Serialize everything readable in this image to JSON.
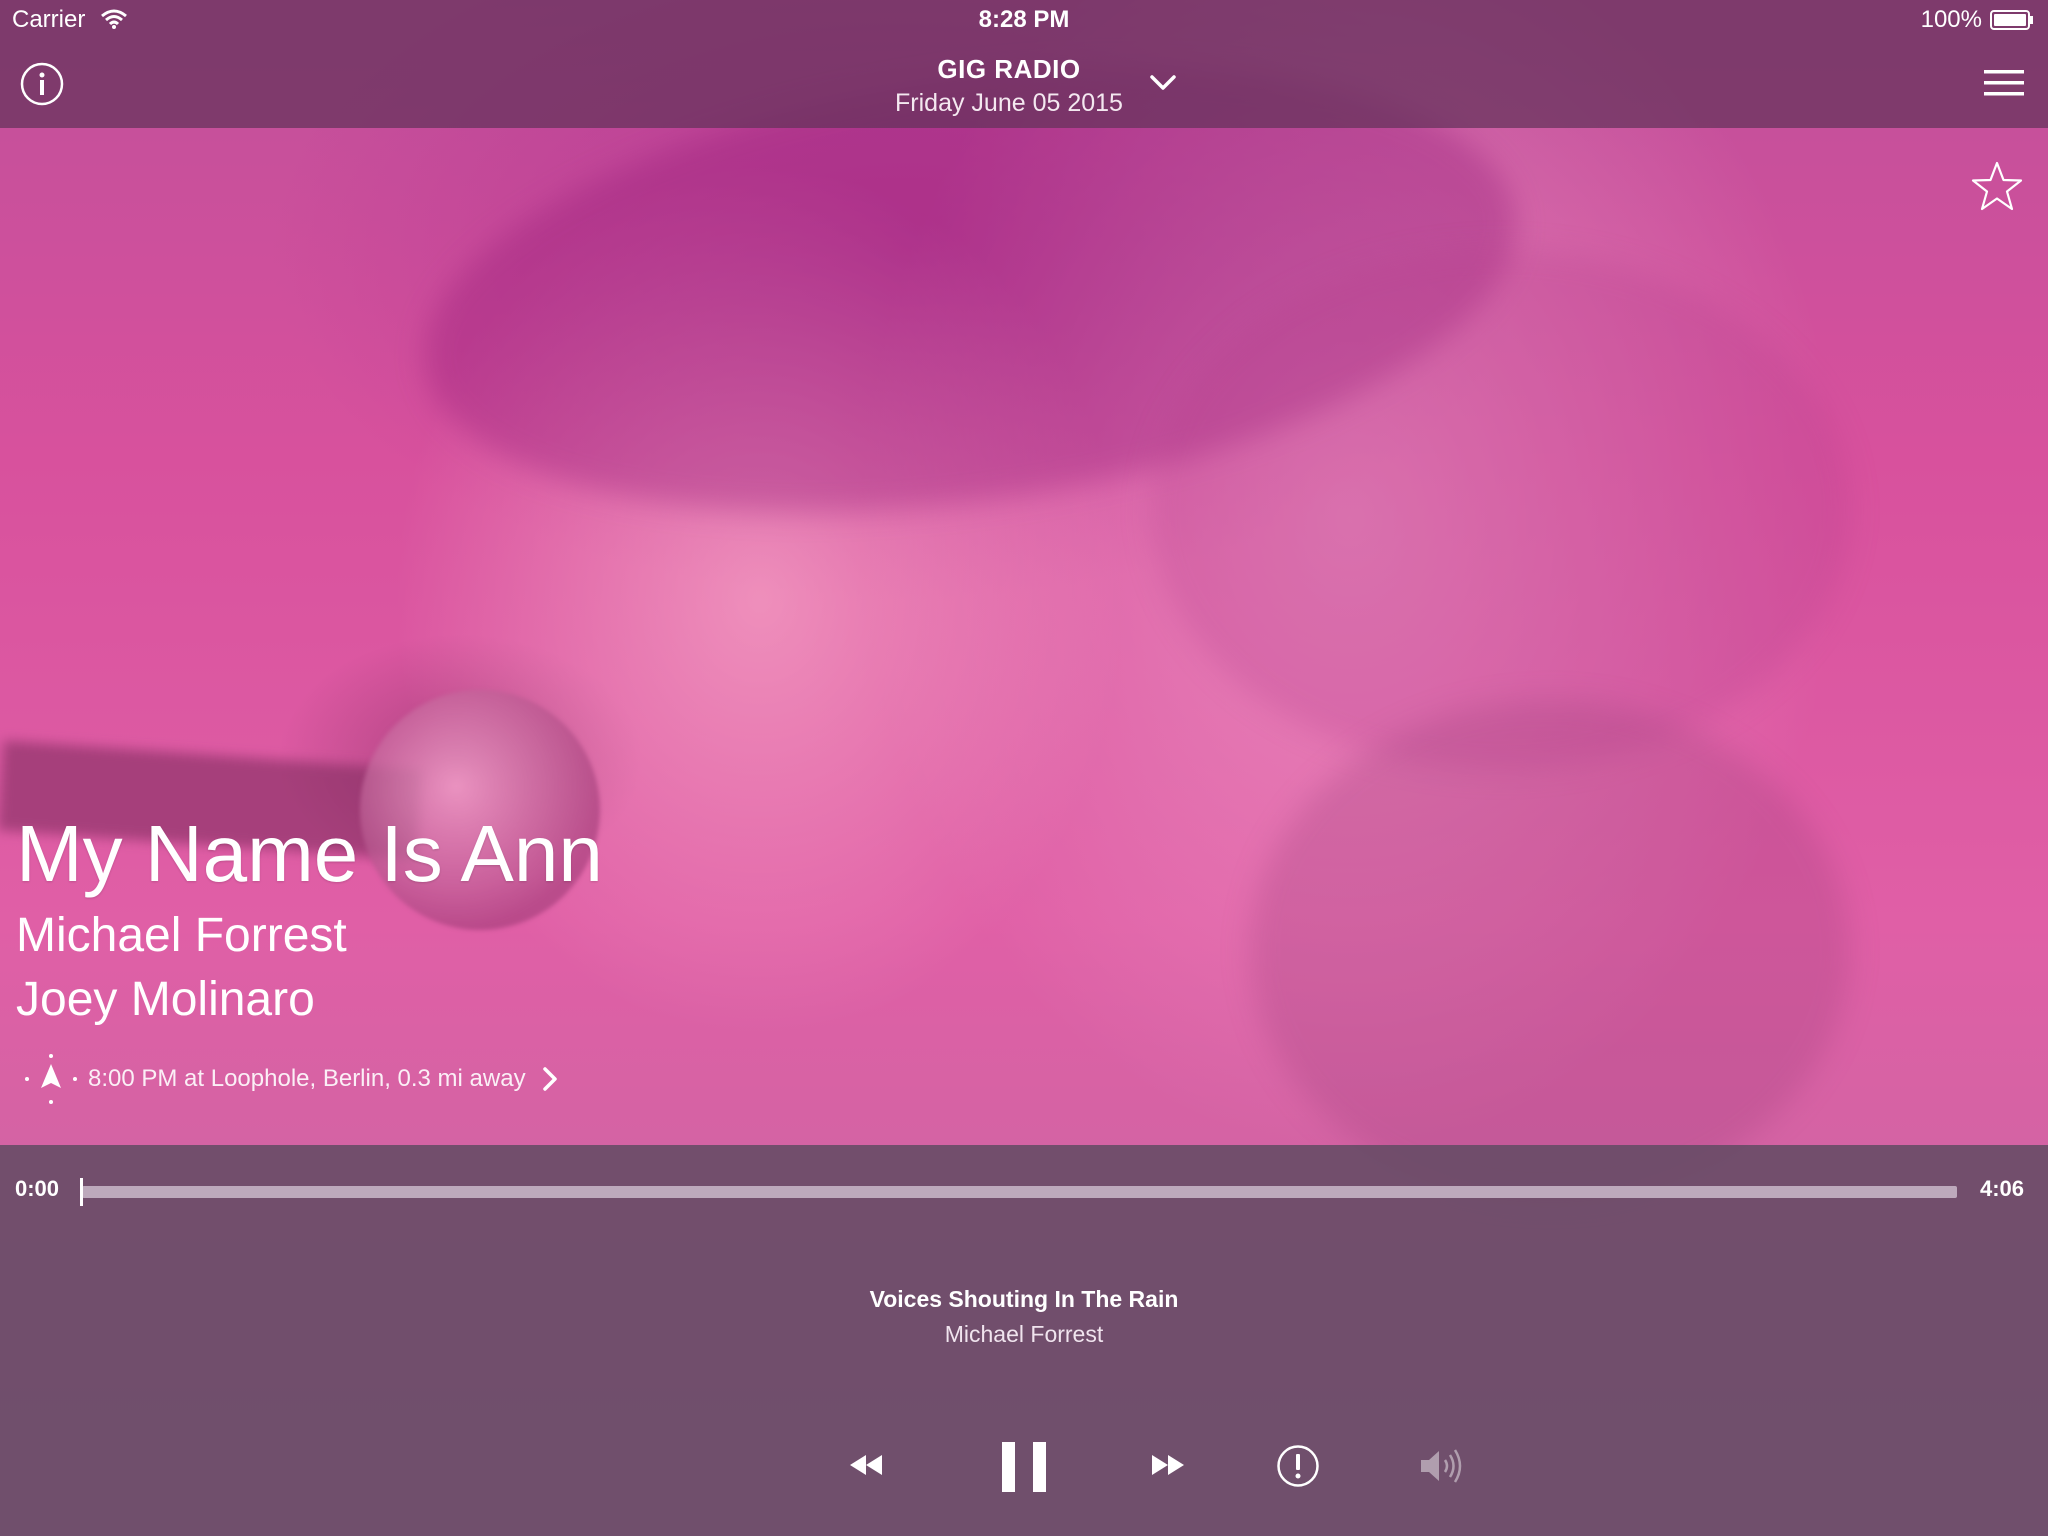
{
  "status_bar": {
    "carrier": "Carrier",
    "time": "8:28 PM",
    "battery": "100%"
  },
  "nav": {
    "station_name": "GIG RADIO",
    "date": "Friday June 05 2015",
    "icons": [
      "info-icon",
      "chevron-down-icon",
      "menu-icon",
      "star-icon"
    ]
  },
  "now_playing": {
    "title": "My Name Is Ann",
    "artists": [
      "Michael Forrest",
      "Joey Molinaro"
    ],
    "location": "8:00 PM at Loophole, Berlin, 0.3 mi away"
  },
  "progress": {
    "elapsed": "0:00",
    "duration": "4:06",
    "fraction": 0.0
  },
  "up_next": {
    "title": "Voices Shouting In The Rain",
    "artist": "Michael Forrest"
  },
  "controls": [
    "rewind-icon",
    "pause-icon",
    "fast-forward-icon",
    "alert-icon",
    "volume-icon"
  ],
  "colors": {
    "accent_pink": "#e05fa6",
    "overlay": "#64325a",
    "text": "#ffffff"
  }
}
